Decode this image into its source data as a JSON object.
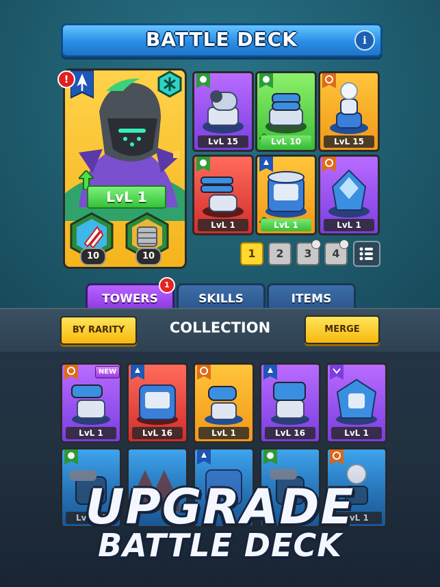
{
  "header": {
    "title": "BATTLE DECK",
    "info_label": "i"
  },
  "hero": {
    "level": "LvL 1",
    "alert": "!",
    "skills": [
      {
        "name": "missile-skill",
        "count": "10"
      },
      {
        "name": "shield-skill",
        "count": "10"
      }
    ]
  },
  "deck": {
    "cards": [
      {
        "level": "LvL 15",
        "rarity": "purple"
      },
      {
        "level": "LvL 10",
        "rarity": "green",
        "upgradable": true
      },
      {
        "level": "LvL 15",
        "rarity": "orange"
      },
      {
        "level": "LvL 1",
        "rarity": "red"
      },
      {
        "level": "LvL 1",
        "rarity": "orange",
        "upgradable": true
      },
      {
        "level": "LvL 1",
        "rarity": "purple"
      }
    ],
    "pages": [
      "1",
      "2",
      "3",
      "4"
    ],
    "active_page": "1"
  },
  "tabs": [
    {
      "label": "TOWERS",
      "badge": "1"
    },
    {
      "label": "SKILLS"
    },
    {
      "label": "ITEMS"
    }
  ],
  "collection": {
    "title": "COLLECTION",
    "sort_label": "BY RARITY",
    "merge_label": "MERGE",
    "new_label": "NEW",
    "cards": [
      {
        "level": "LvL 1",
        "rarity": "purple"
      },
      {
        "level": "LvL 16",
        "rarity": "red"
      },
      {
        "level": "LvL 1",
        "rarity": "orange"
      },
      {
        "level": "LvL 16",
        "rarity": "purple"
      },
      {
        "level": "LvL 1",
        "rarity": "purple"
      },
      {
        "level": "LvL 14",
        "rarity": "blue"
      },
      {
        "level": "",
        "rarity": "blue"
      },
      {
        "level": "",
        "rarity": "blue"
      },
      {
        "level": "",
        "rarity": "blue"
      },
      {
        "level": "LvL 1",
        "rarity": "blue"
      }
    ]
  },
  "promo": {
    "line1": "UPGRADE",
    "line2": "BATTLE DECK"
  },
  "colors": {
    "accent_yellow": "#f7b90d",
    "tab_active": "#8a33e0",
    "banner_blue": "#2a8ee6"
  }
}
